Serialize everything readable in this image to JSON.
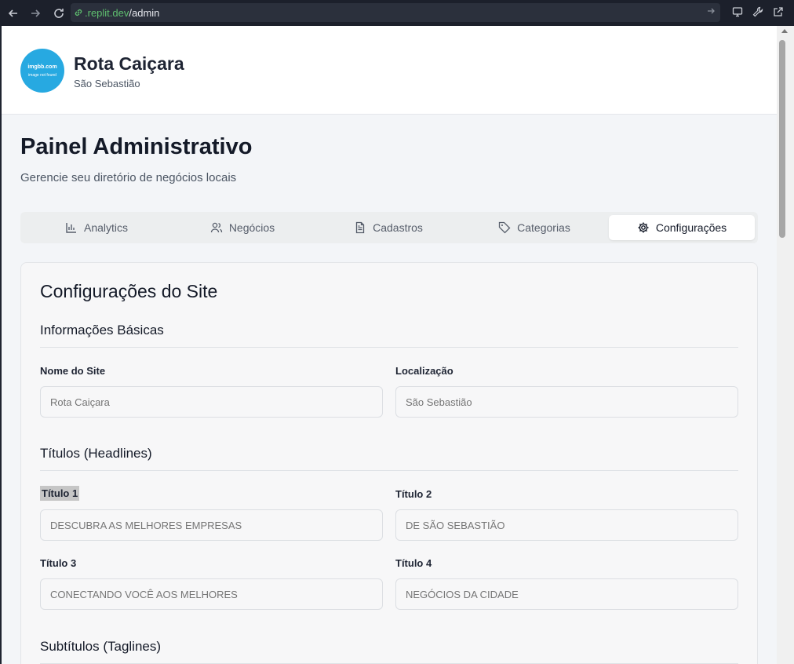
{
  "browser": {
    "url_domain": ".replit.dev",
    "url_path": "/admin"
  },
  "header": {
    "logo_line1": "imgbb.com",
    "logo_line2": "image not found",
    "brand_name": "Rota Caiçara",
    "brand_city": "São Sebastião"
  },
  "page": {
    "title": "Painel Administrativo",
    "subtitle": "Gerencie seu diretório de negócios locais"
  },
  "tabs": [
    {
      "label": "Analytics",
      "icon": "bar-chart-icon"
    },
    {
      "label": "Negócios",
      "icon": "users-icon"
    },
    {
      "label": "Cadastros",
      "icon": "file-text-icon"
    },
    {
      "label": "Categorias",
      "icon": "tag-icon"
    },
    {
      "label": "Configurações",
      "icon": "gear-icon",
      "active": true
    }
  ],
  "settings": {
    "title": "Configurações do Site",
    "basic": {
      "title": "Informações Básicas",
      "site_name_label": "Nome do Site",
      "site_name_placeholder": "Rota Caiçara",
      "location_label": "Localização",
      "location_placeholder": "São Sebastião"
    },
    "headlines": {
      "title": "Títulos (Headlines)",
      "t1_label": "Título 1",
      "t1_placeholder": "DESCUBRA AS MELHORES EMPRESAS",
      "t2_label": "Título 2",
      "t2_placeholder": "DE SÃO SEBASTIÃO",
      "t3_label": "Título 3",
      "t3_placeholder": "CONECTANDO VOCÊ AOS MELHORES",
      "t4_label": "Título 4",
      "t4_placeholder": "NEGÓCIOS DA CIDADE"
    },
    "taglines": {
      "title": "Subtítulos (Taglines)"
    }
  }
}
